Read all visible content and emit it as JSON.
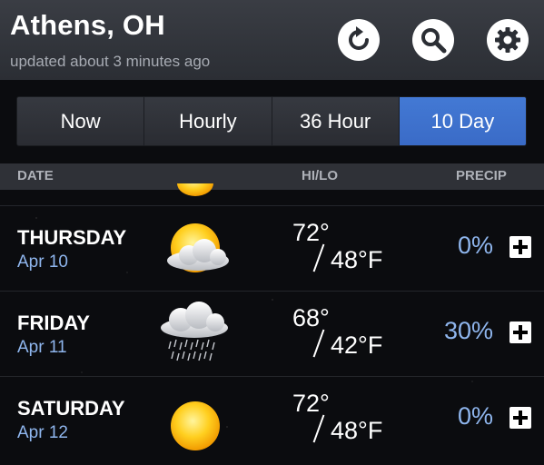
{
  "header": {
    "city": "Athens, OH",
    "updated": "updated about 3 minutes ago",
    "buttons": [
      "refresh-icon",
      "search-icon",
      "gear-icon"
    ]
  },
  "tabs": [
    {
      "label": "Now",
      "active": false
    },
    {
      "label": "Hourly",
      "active": false
    },
    {
      "label": "36 Hour",
      "active": false
    },
    {
      "label": "10 Day",
      "active": true
    }
  ],
  "columns": {
    "date": "DATE",
    "hilo": "HI/LO",
    "precip": "PRECIP"
  },
  "days": [
    {
      "day": "THURSDAY",
      "date": "Apr 10",
      "hi": "72°",
      "lo": "48°F",
      "precip": "0%",
      "icon": "partly-cloudy-icon"
    },
    {
      "day": "FRIDAY",
      "date": "Apr 11",
      "hi": "68°",
      "lo": "42°F",
      "precip": "30%",
      "icon": "rain-icon"
    },
    {
      "day": "SATURDAY",
      "date": "Apr 12",
      "hi": "72°",
      "lo": "48°F",
      "precip": "0%",
      "icon": "sun-icon"
    }
  ],
  "colors": {
    "accent": "#3a6bc7",
    "date_text": "#8fb6ee",
    "header_bg": "#2f3137"
  }
}
